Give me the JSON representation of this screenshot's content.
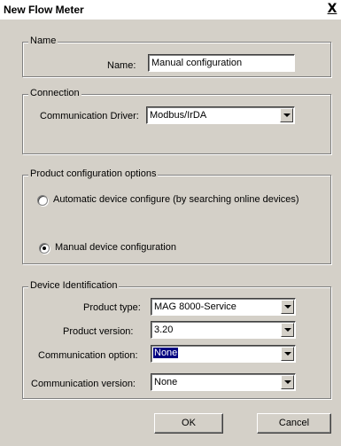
{
  "window": {
    "title": "New Flow Meter",
    "close_glyph": "X"
  },
  "name_group": {
    "legend": "Name",
    "name_label": "Name:",
    "name_value": "Manual configuration"
  },
  "connection_group": {
    "legend": "Connection",
    "driver_label": "Communication Driver:",
    "driver_value": "Modbus/IrDA"
  },
  "product_config_group": {
    "legend": "Product configuration options",
    "option_auto": {
      "label": "Automatic device configure (by searching online devices)",
      "selected": false
    },
    "option_manual": {
      "label": "Manual device configuration",
      "selected": true
    }
  },
  "device_id_group": {
    "legend": "Device Identification",
    "product_type_label": "Product type:",
    "product_type_value": "MAG 8000-Service",
    "product_version_label": "Product version:",
    "product_version_value": "3.20",
    "comm_option_label": "Communication option:",
    "comm_option_value": "None",
    "comm_version_label": "Communication version:",
    "comm_version_value": "None"
  },
  "buttons": {
    "ok": "OK",
    "cancel": "Cancel"
  },
  "icons": {
    "dropdown": "chevron-down-icon",
    "close": "close-icon"
  }
}
